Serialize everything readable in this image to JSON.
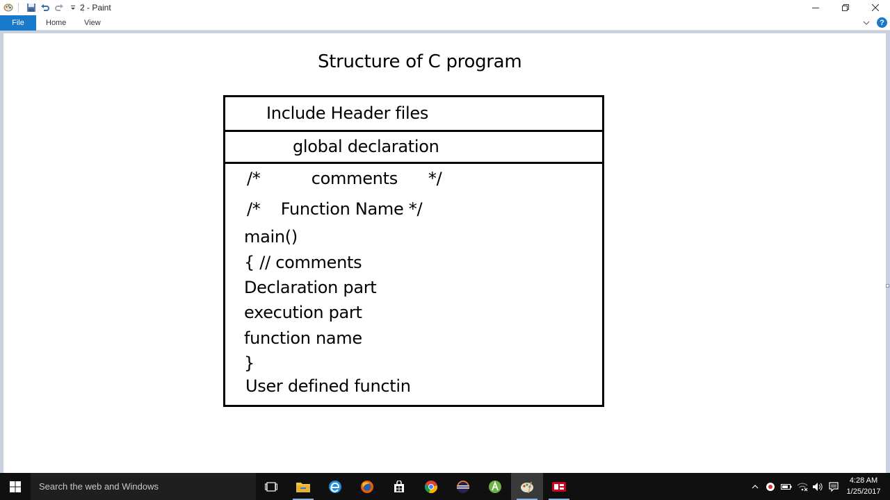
{
  "window": {
    "title": "2 - Paint"
  },
  "ribbon": {
    "tabs": [
      "File",
      "Home",
      "View"
    ]
  },
  "diagram": {
    "title": "Structure of C program",
    "header_row": "Include Header files",
    "global_row": "global declaration",
    "body_lines": [
      "/*          comments      */",
      "/*    Function Name */",
      "main()",
      "{ // comments",
      "Declaration part",
      "execution part",
      "function name",
      "}",
      "User defined functin"
    ]
  },
  "taskbar": {
    "search_placeholder": "Search the web and Windows",
    "pinned_icons": [
      "task-view-icon",
      "file-explorer-icon",
      "edge-icon",
      "firefox-icon",
      "store-icon",
      "chrome-icon",
      "eclipse-icon",
      "android-studio-icon",
      "paint-icon",
      "codeblocks-icon"
    ],
    "clock_time": "4:28 AM",
    "clock_date": "1/25/2017"
  },
  "colors": {
    "file_tab": "#1979ca",
    "workspace": "#c8d1dd",
    "taskbar": "#101010"
  }
}
